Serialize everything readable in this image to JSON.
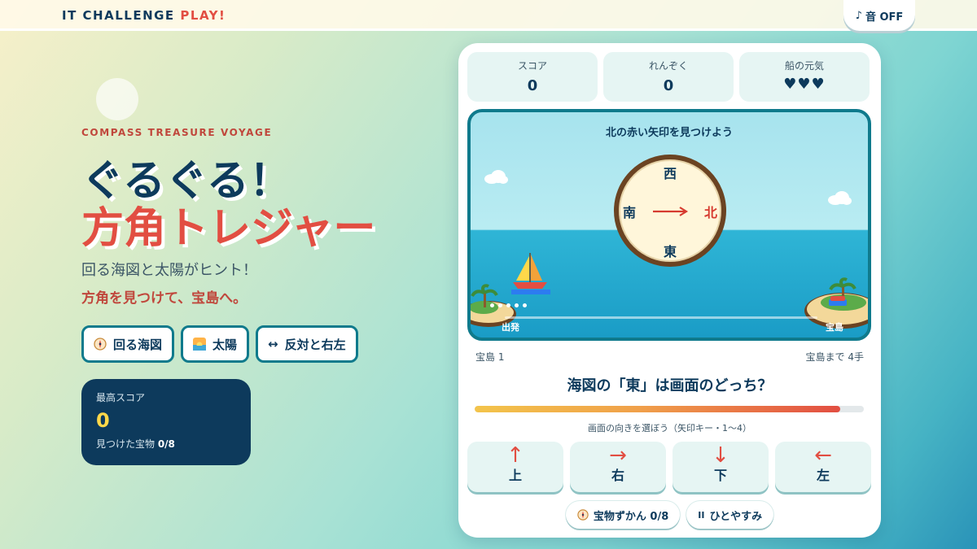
{
  "brand": {
    "main": "IT CHALLENGE ",
    "accent": "PLAY!"
  },
  "sound": {
    "icon": "music-note-icon",
    "label": "音 OFF"
  },
  "hero": {
    "eyebrow": "COMPASS TREASURE VOYAGE",
    "title_line1": "ぐるぐる！",
    "title_line2": "方角トレジャー",
    "subtitle": "回る海図と太陽がヒント！",
    "tagline": "方角を見つけて、宝島へ。"
  },
  "hints": [
    {
      "icon": "compass-icon",
      "label": "回る海図"
    },
    {
      "icon": "sunrise-icon",
      "label": "太陽"
    },
    {
      "icon": "swap-arrows-icon",
      "label": "反対と右左"
    }
  ],
  "best": {
    "label": "最高スコア",
    "score": "0",
    "found_label": "見つけた宝物 ",
    "found_value": "0/8"
  },
  "stats": [
    {
      "label": "スコア",
      "value": "0"
    },
    {
      "label": "れんぞく",
      "value": "0"
    },
    {
      "label": "船の元気",
      "value": "♥♥♥"
    }
  ],
  "scene": {
    "prompt": "北の赤い矢印を見つけよう",
    "compass": {
      "top": "西",
      "bottom": "東",
      "left": "南",
      "right": "北",
      "highlight": "north"
    },
    "start_label": "出発",
    "goal_label": "宝島",
    "progress_steps_done": 0,
    "progress_steps_total": 5
  },
  "level": {
    "left": "宝島 1",
    "right": "宝島まで 4手"
  },
  "question": "海図の「東」は画面のどっち？",
  "timer": {
    "fraction": 0.94
  },
  "choose_hint": "画面の向きを選ぼう（矢印キー・1〜4）",
  "answers": [
    {
      "arrow": "↑",
      "label": "上"
    },
    {
      "arrow": "→",
      "label": "右"
    },
    {
      "arrow": "↓",
      "label": "下"
    },
    {
      "arrow": "←",
      "label": "左"
    }
  ],
  "footer": [
    {
      "icon": "compass-icon",
      "label": "宝物ずかん 0/8"
    },
    {
      "icon": "pause-icon",
      "label": "ひとやすみ"
    }
  ],
  "colors": {
    "accent": "#e24e42",
    "navy": "#0d3a5c",
    "teal": "#0f7a8c",
    "gold": "#ffd84a"
  }
}
